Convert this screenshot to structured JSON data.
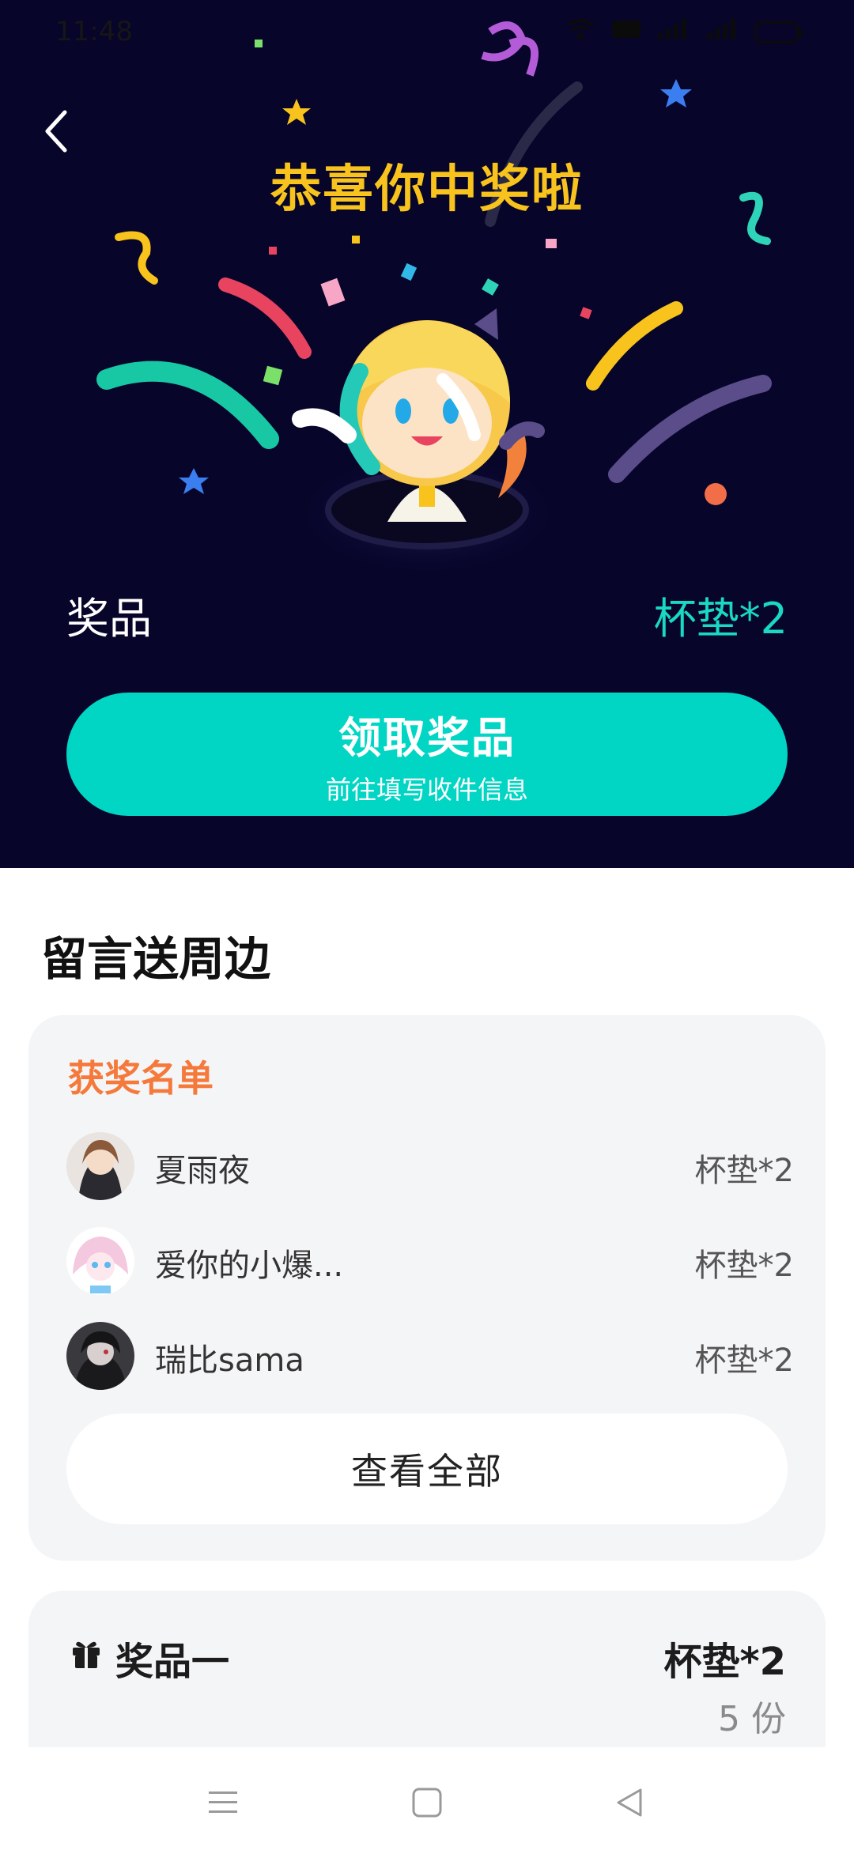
{
  "status_bar": {
    "time": "11:48"
  },
  "hero": {
    "title": "恭喜你中奖啦",
    "prize_label": "奖品",
    "prize_value": "杯垫*2",
    "claim_button": {
      "label": "领取奖品",
      "sublabel": "前往填写收件信息"
    }
  },
  "section": {
    "title": "留言送周边"
  },
  "winners": {
    "title": "获奖名单",
    "items": [
      {
        "name": "夏雨夜",
        "prize": "杯垫*2"
      },
      {
        "name": "爱你的小爆...",
        "prize": "杯垫*2"
      },
      {
        "name": "瑞比sama",
        "prize": "杯垫*2"
      }
    ],
    "view_all_label": "查看全部"
  },
  "prize_card": {
    "icon": "gift-icon",
    "title": "奖品一",
    "value": "杯垫*2",
    "count": "5 份"
  },
  "colors": {
    "hero_bg": "#07052a",
    "title_yellow": "#f8c31c",
    "accent_teal": "#00d6c3",
    "winners_orange": "#f5793a"
  }
}
